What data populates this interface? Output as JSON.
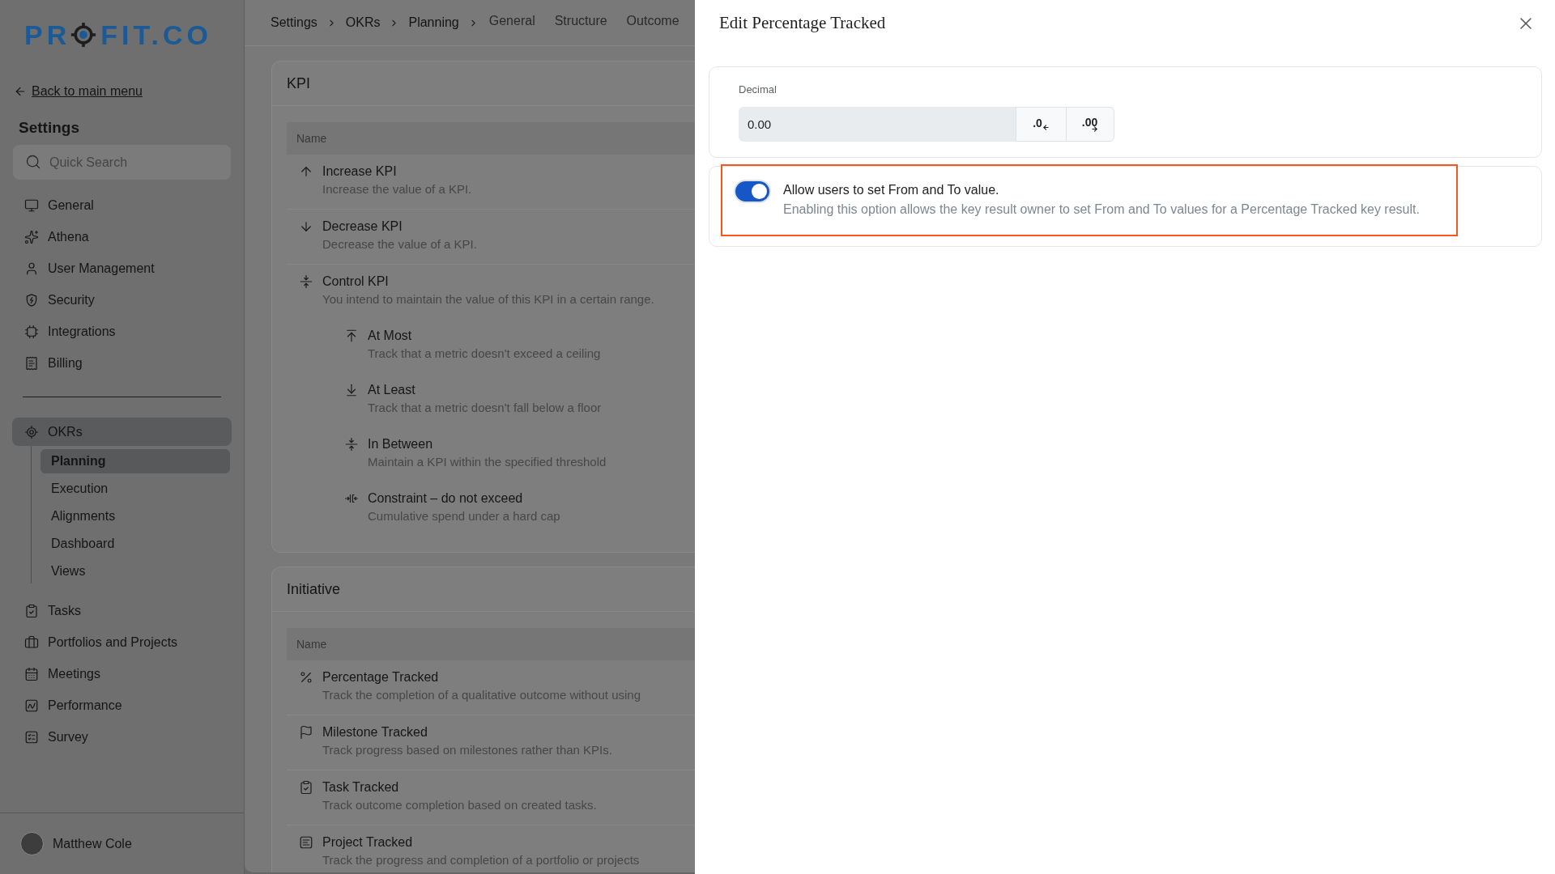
{
  "sidebar": {
    "logo": {
      "text_start": "PR",
      "text_end": "FIT.CO"
    },
    "back_link": "Back to main menu",
    "heading": "Settings",
    "search": {
      "placeholder": "Quick Search"
    },
    "nav_groups": [
      {
        "items": [
          {
            "label": "General",
            "selected": false
          },
          {
            "label": "Athena",
            "selected": false
          },
          {
            "label": "User Management",
            "selected": false
          },
          {
            "label": "Security",
            "selected": false
          },
          {
            "label": "Integrations",
            "selected": false
          },
          {
            "label": "Billing",
            "selected": false
          }
        ]
      },
      {
        "items": [
          {
            "label": "OKRs",
            "selected": true,
            "children": [
              {
                "label": "Planning",
                "selected": true
              },
              {
                "label": "Execution",
                "selected": false
              },
              {
                "label": "Alignments",
                "selected": false
              },
              {
                "label": "Dashboard",
                "selected": false
              },
              {
                "label": "Views",
                "selected": false
              }
            ]
          },
          {
            "label": "Tasks",
            "selected": false
          },
          {
            "label": "Portfolios and Projects",
            "selected": false
          },
          {
            "label": "Meetings",
            "selected": false
          },
          {
            "label": "Performance",
            "selected": false
          },
          {
            "label": "Survey",
            "selected": false
          }
        ]
      }
    ],
    "user": {
      "name": "Matthew Cole"
    }
  },
  "header": {
    "breadcrumb": [
      "Settings",
      "OKRs",
      "Planning"
    ],
    "tabs": [
      {
        "label": "General",
        "selected": false
      },
      {
        "label": "Structure",
        "selected": false
      },
      {
        "label": "Outcome",
        "selected": false
      }
    ]
  },
  "cards": [
    {
      "title": "KPI",
      "column_header": "Name",
      "rows": [
        {
          "title": "Increase KPI",
          "description": "Increase the value of a KPI."
        },
        {
          "title": "Decrease KPI",
          "description": "Decrease the value of a KPI."
        },
        {
          "title": "Control KPI",
          "description": "You intend to maintain the value of this KPI in a certain range.",
          "children": [
            {
              "title": "At Most",
              "description": "Track that a metric doesn't exceed a ceiling"
            },
            {
              "title": "At Least",
              "description": "Track that a metric doesn't fall below a floor"
            },
            {
              "title": "In Between",
              "description": "Maintain a KPI within the specified threshold"
            },
            {
              "title": "Constraint – do not exceed",
              "description": "Cumulative spend under a hard cap"
            }
          ]
        }
      ]
    },
    {
      "title": "Initiative",
      "column_header": "Name",
      "rows": [
        {
          "title": "Percentage Tracked",
          "description": "Track the completion of a qualitative outcome without using"
        },
        {
          "title": "Milestone Tracked",
          "description": "Track progress based on milestones rather than KPIs."
        },
        {
          "title": "Task Tracked",
          "description": "Track outcome completion based on created tasks."
        },
        {
          "title": "Project Tracked",
          "description": "Track the progress and completion of a portfolio or projects"
        }
      ]
    }
  ],
  "drawer": {
    "title": "Edit Percentage Tracked",
    "decimal": {
      "label": "Decimal",
      "value": "0.00",
      "decrease_button": ".0",
      "increase_button": ".00"
    },
    "option": {
      "on": true,
      "highlighted": true,
      "label": "Allow users to set From and To value.",
      "description": "Enabling this option allows the key result owner to set From and To values for a Percentage Tracked key result."
    }
  }
}
